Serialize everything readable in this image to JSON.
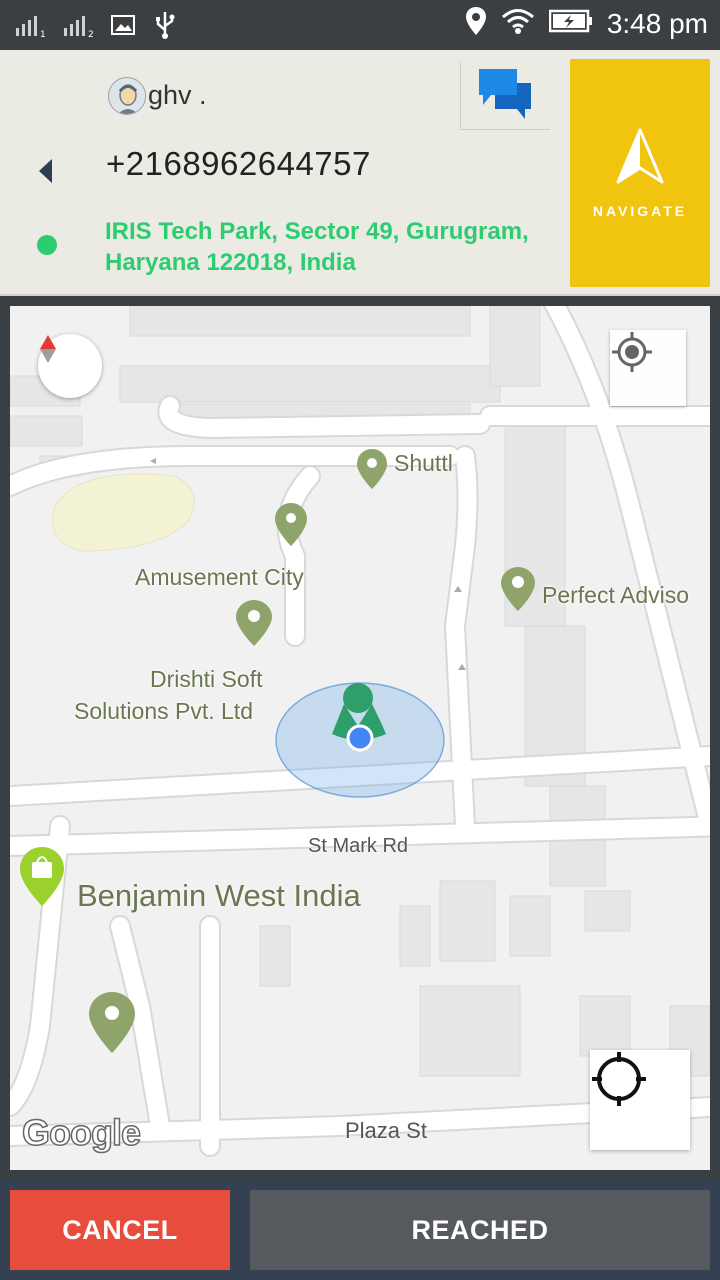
{
  "status_bar": {
    "time": "3:48 pm",
    "icons": [
      "signal-sim1-icon",
      "signal-sim2-icon",
      "image-icon",
      "usb-icon",
      "location-icon",
      "wifi-icon",
      "battery-charging-icon"
    ]
  },
  "contact": {
    "name": "ghv .",
    "phone": "+2168962644757",
    "address": "IRIS Tech Park, Sector 49, Gurugram, Haryana 122018, India"
  },
  "actions": {
    "navigate_label": "NAVIGATE",
    "cancel_label": "CANCEL",
    "reached_label": "REACHED"
  },
  "map": {
    "pois": [
      {
        "name": "Shuttl"
      },
      {
        "name": "Amusement City"
      },
      {
        "name": "Perfect Adviso"
      },
      {
        "name": "Drishti Soft"
      },
      {
        "name": "Solutions Pvt. Ltd"
      }
    ],
    "roads": [
      "St Mark Rd",
      "Plaza St"
    ],
    "store": "Benjamin West India",
    "attribution": "Google"
  },
  "colors": {
    "accent_green": "#2ecc71",
    "navigate_yellow": "#f1c40f",
    "cancel_red": "#e74c3c",
    "reached_gray": "#565a5e",
    "status_bar": "#3b3f42"
  }
}
